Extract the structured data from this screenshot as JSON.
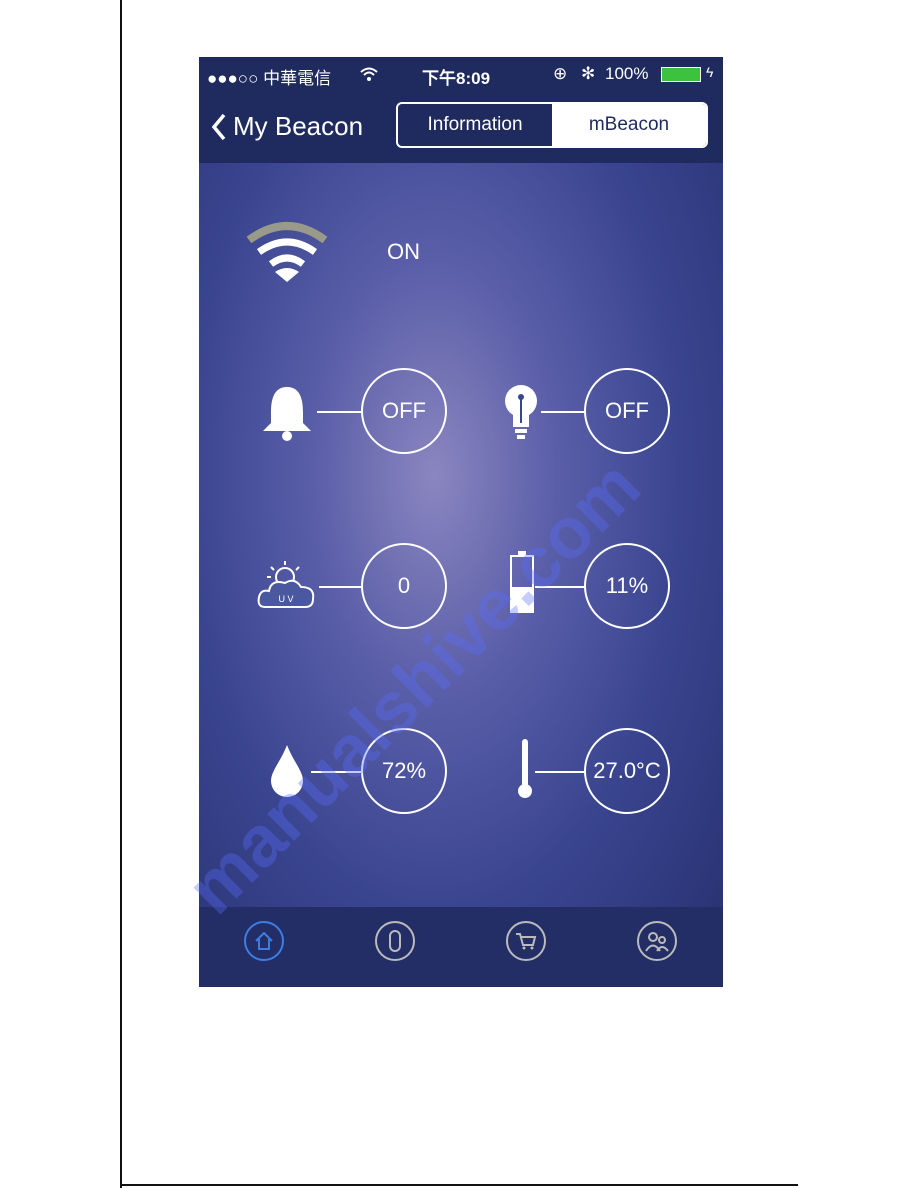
{
  "status_bar": {
    "carrier": "●●●○○ 中華電信",
    "time": "下午8:09",
    "battery": "100%",
    "battery_level": 100
  },
  "nav": {
    "back_label": "My Beacon",
    "segments": [
      {
        "label": "Information",
        "selected": false
      },
      {
        "label": "mBeacon",
        "selected": true
      }
    ]
  },
  "sensors": {
    "wifi": {
      "icon": "wifi-icon",
      "value": "ON"
    },
    "alarm": {
      "icon": "bell-icon",
      "value": "OFF"
    },
    "light": {
      "icon": "lightbulb-icon",
      "value": "OFF"
    },
    "uv": {
      "icon": "uv-weather-icon",
      "icon_text": "U V",
      "value": "0"
    },
    "battery": {
      "icon": "battery-icon",
      "value": "11%"
    },
    "humidity": {
      "icon": "water-drop-icon",
      "value": "72%"
    },
    "temperature": {
      "icon": "thermometer-icon",
      "value": "27.0°C"
    }
  },
  "tabbar": {
    "items": [
      {
        "icon": "home-icon",
        "active": true
      },
      {
        "icon": "beacon-device-icon"
      },
      {
        "icon": "cart-icon"
      },
      {
        "icon": "users-icon"
      }
    ],
    "active_color": "#3d7ee6"
  },
  "watermark": "manualshive.com"
}
